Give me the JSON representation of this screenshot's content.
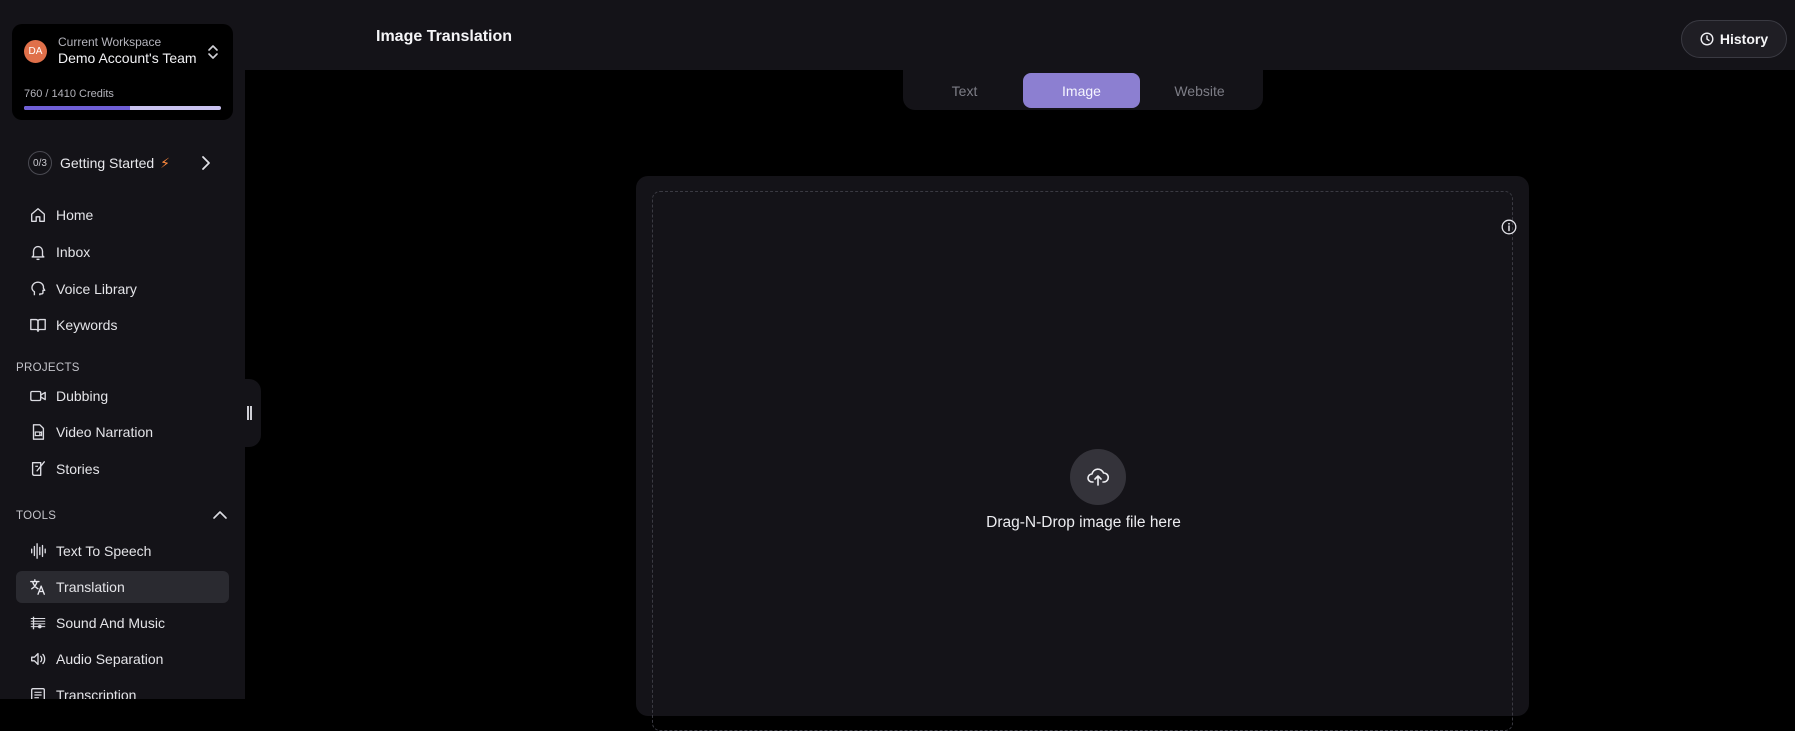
{
  "workspace": {
    "avatar_initials": "DA",
    "caption": "Current Workspace",
    "name": "Demo Account's Team",
    "credits_text": "760 / 1410 Credits",
    "credits_used": 760,
    "credits_total": 1410
  },
  "getting_started": {
    "count": "0/3",
    "label": "Getting Started",
    "bolt": "⚡"
  },
  "nav": {
    "home": "Home",
    "inbox": "Inbox",
    "voice_library": "Voice Library",
    "keywords": "Keywords"
  },
  "projects": {
    "title": "PROJECTS",
    "dubbing": "Dubbing",
    "video_narration": "Video Narration",
    "stories": "Stories"
  },
  "tools": {
    "title": "TOOLS",
    "text_to_speech": "Text To Speech",
    "translation": "Translation",
    "sound_and_music": "Sound And Music",
    "audio_separation": "Audio Separation",
    "transcription": "Transcription"
  },
  "header": {
    "title": "Image Translation",
    "history_label": "History"
  },
  "tabs": [
    "Text",
    "Image",
    "Website"
  ],
  "active_tab": "Image",
  "dropzone": {
    "text": "Drag-N-Drop image file here"
  },
  "colors": {
    "accent": "#8c7fd1",
    "credits_bar": "#6f5fd6",
    "avatar": "#e0704a",
    "bolt": "#ff8a3d"
  }
}
